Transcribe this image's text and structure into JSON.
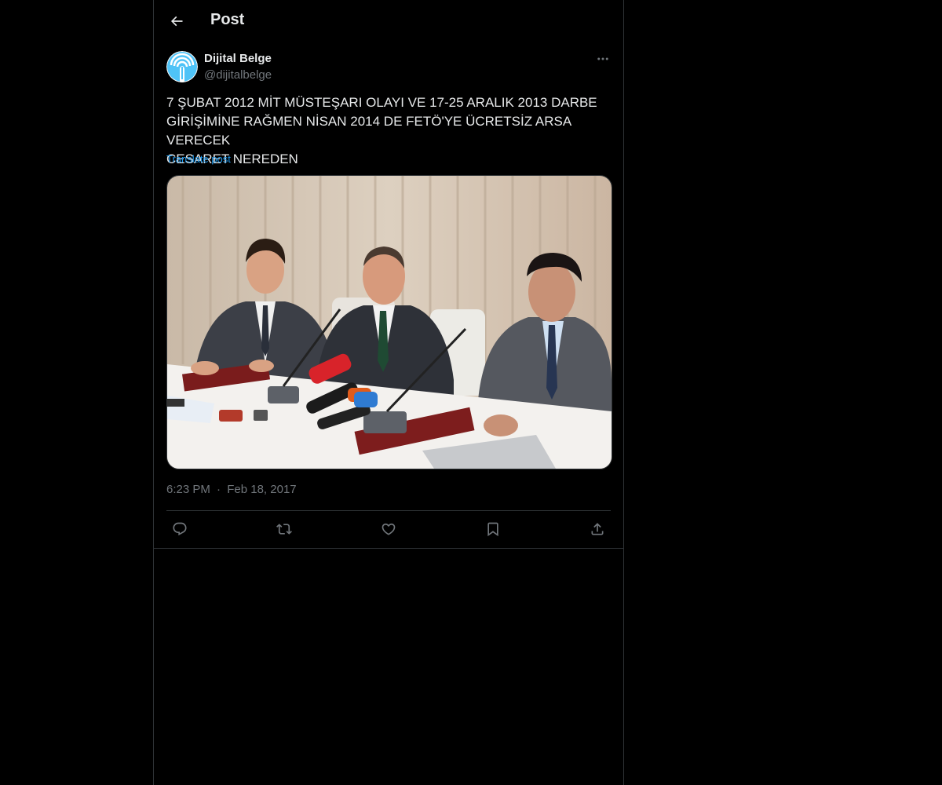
{
  "header": {
    "title": "Post",
    "back_icon": "arrow-left-icon"
  },
  "author": {
    "display_name": "Dijital Belge",
    "handle": "@dijitalbelge",
    "avatar_icon": "avatar-logo-icon",
    "avatar_color": "#4fc3f7"
  },
  "post": {
    "text": "7 ŞUBAT 2012 MİT MÜSTEŞARI OLAYI VE 17-25 ARALIK 2013 DARBE\nGİRİŞİMİNE RAĞMEN NİSAN 2014 DE FETÖ'YE ÜCRETSİZ ARSA VERECEK\nCESARET NEREDEN",
    "translate_label": "Translate post",
    "time": "6:23 PM",
    "separator": "·",
    "date": "Feb 18, 2017"
  },
  "actions": [
    {
      "name": "reply",
      "icon": "reply-icon"
    },
    {
      "name": "repost",
      "icon": "repost-icon"
    },
    {
      "name": "like",
      "icon": "heart-icon"
    },
    {
      "name": "bookmark",
      "icon": "bookmark-icon"
    },
    {
      "name": "share",
      "icon": "share-icon"
    }
  ],
  "colors": {
    "background": "#000000",
    "text_primary": "#e7e9ea",
    "text_secondary": "#71767b",
    "link": "#1d9bf0",
    "border": "#2f3336"
  }
}
